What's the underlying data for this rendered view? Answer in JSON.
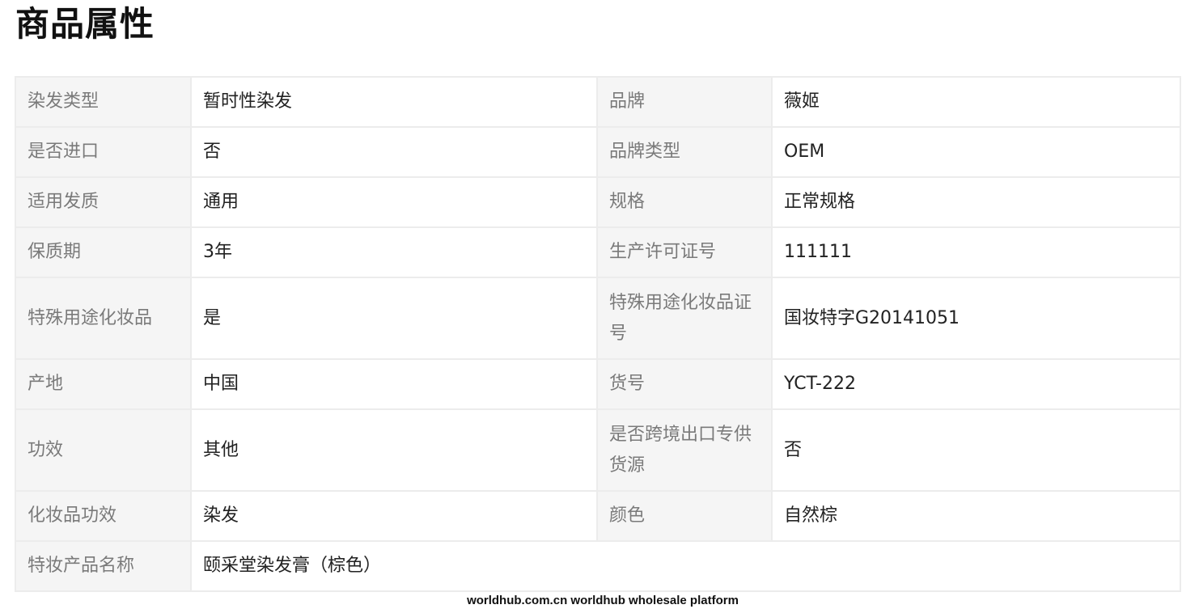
{
  "page": {
    "title": "商品属性"
  },
  "rows": [
    [
      {
        "k": "染发类型",
        "v": "暂时性染发"
      },
      {
        "k": "品牌",
        "v": "薇姬"
      }
    ],
    [
      {
        "k": "是否进口",
        "v": "否"
      },
      {
        "k": "品牌类型",
        "v": "OEM"
      }
    ],
    [
      {
        "k": "适用发质",
        "v": "通用"
      },
      {
        "k": "规格",
        "v": "正常规格"
      }
    ],
    [
      {
        "k": "保质期",
        "v": "3年"
      },
      {
        "k": "生产许可证号",
        "v": "111111"
      }
    ],
    [
      {
        "k": "特殊用途化妆品",
        "v": "是"
      },
      {
        "k": "特殊用途化妆品证号",
        "v": "国妆特字G20141051"
      }
    ],
    [
      {
        "k": "产地",
        "v": "中国"
      },
      {
        "k": "货号",
        "v": "YCT-222"
      }
    ],
    [
      {
        "k": "功效",
        "v": "其他"
      },
      {
        "k": "是否跨境出口专供货源",
        "v": "否"
      }
    ],
    [
      {
        "k": "化妆品功效",
        "v": "染发"
      },
      {
        "k": "颜色",
        "v": "自然棕"
      }
    ],
    [
      {
        "k": "特妆产品名称",
        "v": "颐采堂染发膏（棕色）"
      }
    ]
  ],
  "watermark": "worldhub.com.cn worldhub wholesale platform"
}
